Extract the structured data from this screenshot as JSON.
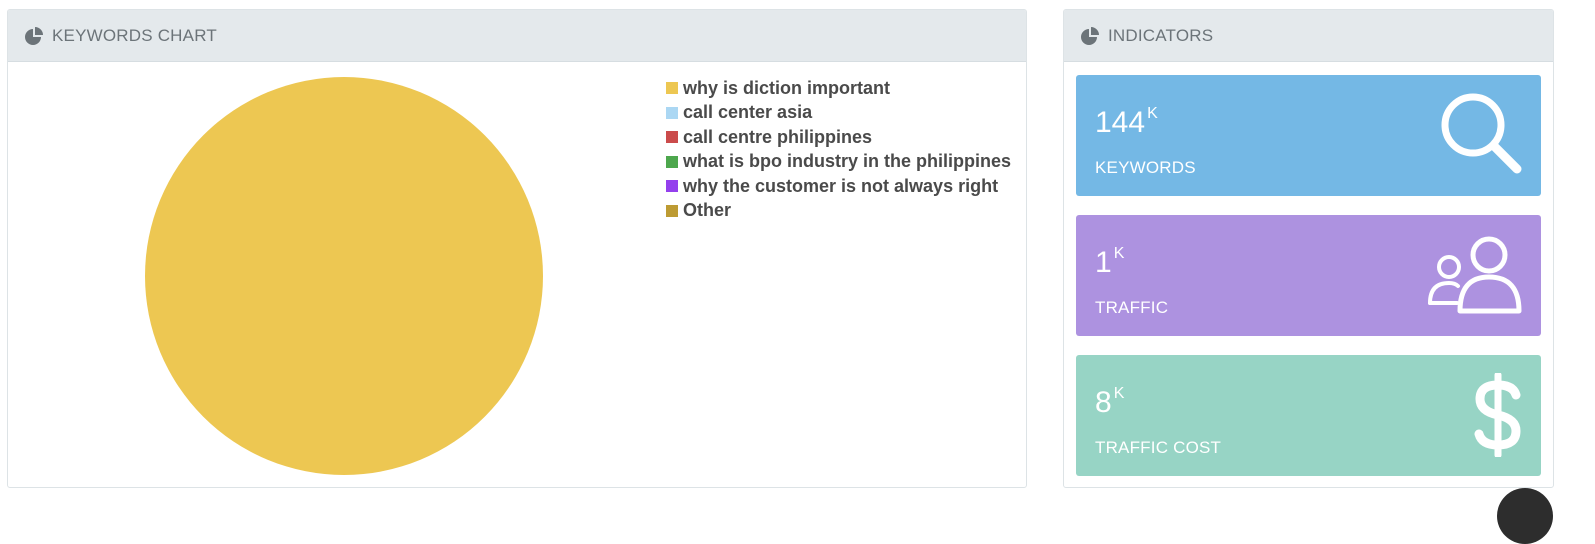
{
  "keywords_panel": {
    "title": "KEYWORDS CHART",
    "icon": "pie-chart-icon"
  },
  "indicators_panel": {
    "title": "INDICATORS",
    "icon": "pie-chart-icon"
  },
  "chart_data": {
    "type": "pie",
    "categories": [
      "why is diction important",
      "call center asia",
      "call centre philippines",
      "what is bpo industry in the philippines",
      "why the customer is not always right",
      "Other"
    ],
    "values": [
      100,
      0,
      0,
      0,
      0,
      0
    ],
    "colors": [
      "#edc752",
      "#abd7f3",
      "#cb4b4b",
      "#4da74d",
      "#9440ed",
      "#bd9b33"
    ],
    "legend_position": "right"
  },
  "indicators": [
    {
      "value": "144",
      "unit": "K",
      "label": "KEYWORDS",
      "color": "#74b8e5",
      "icon": "search-icon"
    },
    {
      "value": "1",
      "unit": "K",
      "label": "TRAFFIC",
      "color": "#ad92e0",
      "icon": "users-icon"
    },
    {
      "value": "8",
      "unit": "K",
      "label": "TRAFFIC COST",
      "color": "#97d4c5",
      "icon": "dollar-icon"
    }
  ]
}
